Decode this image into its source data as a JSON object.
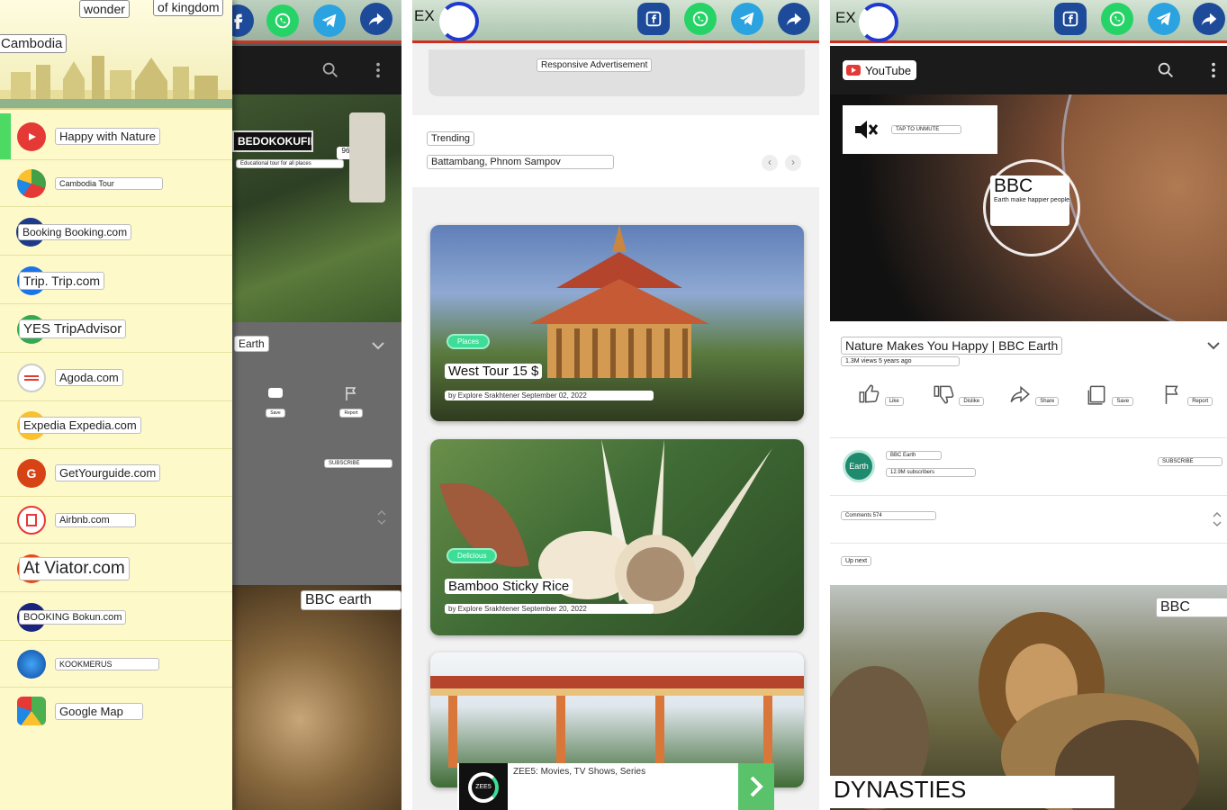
{
  "panel_left": {
    "header": {
      "word1": "wonder",
      "word2": "of kingdom",
      "country": "Cambodia"
    },
    "drawer_items": [
      {
        "label": "Happy with Nature",
        "icon": "youtube-icon",
        "color": "#e53935"
      },
      {
        "label": "Cambodia Tour",
        "icon": "globe-icon",
        "color": "#43a047"
      },
      {
        "label": "Booking Booking.com",
        "icon": "booking-icon",
        "color": "#1e3a8a"
      },
      {
        "label": "Trip. Trip.com",
        "icon": "trip-icon",
        "color": "#1a73e8"
      },
      {
        "label": "YES TripAdvisor",
        "icon": "tripadvisor-icon",
        "color": "#34a853"
      },
      {
        "label": "Agoda.com",
        "icon": "agoda-icon",
        "color": "#ffffff"
      },
      {
        "label": "Expedia Expedia.com",
        "icon": "expedia-icon",
        "color": "#fbc02d"
      },
      {
        "label": "GetYourguide.com",
        "icon": "getyourguide-icon",
        "color": "#d84315"
      },
      {
        "label": "Airbnb.com",
        "icon": "airbnb-icon",
        "color": "#e53935"
      },
      {
        "label": "At Viator.com",
        "icon": "viator-icon",
        "color": "#e64a19"
      },
      {
        "label": "BOOKING Bokun.com",
        "icon": "bokun-icon",
        "color": "#1a237e"
      },
      {
        "label": "KOOKMERUS",
        "icon": "kookmerus-icon",
        "color": "#1565c0"
      },
      {
        "label": "Google Map",
        "icon": "map-icon",
        "color": "#4caf50"
      }
    ],
    "behind": {
      "video_sign": "BEDOKOKUFIRM",
      "video_caption": "Educational tour for all places",
      "badge": "96",
      "title": "Earth",
      "save": "Save",
      "report": "Report",
      "subscribe": "SUBSCRIBE",
      "bbc_tag": "BBC earth"
    }
  },
  "panel_mid": {
    "logo_text": "EX",
    "ad_label": "Responsive Advertisement",
    "trending_label": "Trending",
    "trending_value": "Battambang, Phnom Sampov",
    "cards": [
      {
        "tag": "Places",
        "title": "West Tour 15 $",
        "byline": "by Explore Srakhtener September 02, 2022"
      },
      {
        "tag": "Delicious",
        "title": "Bamboo Sticky Rice",
        "byline": "by Explore Srakhtener September 20, 2022"
      }
    ],
    "bottom_ad": {
      "title": "ZEE5: Movies, TV Shows, Series",
      "app_badge": "ZEE5"
    }
  },
  "panel_right": {
    "logo_text": "EX",
    "youtube_label": "YouTube",
    "tap_unmute": "TAP TO UNMUTE",
    "bbc_logo": "BBC",
    "bbc_sub": "Earth make happier people",
    "video_title": "Nature Makes You Happy | BBC Earth",
    "video_meta": "1.3M views 5 years ago",
    "actions": [
      "Like",
      "Dislike",
      "Share",
      "Save",
      "Report"
    ],
    "channel": {
      "name": "BBC Earth",
      "subs": "12.9M subscribers",
      "avatar": "Earth",
      "subscribe": "SUBSCRIBE"
    },
    "comments": "Comments 574",
    "up_next": "Up next",
    "next_tag": "BBC",
    "next_title": "DYNASTIES"
  },
  "colors": {
    "red_line": "#d52b1e",
    "whatsapp": "#25d366",
    "telegram": "#2aa3e0",
    "share": "#1e4a9a",
    "facebook": "#1e4a9a",
    "drawer_bg": "#fdf9c9",
    "active_green": "#4cd964",
    "tag_green": "#3ddc97"
  }
}
